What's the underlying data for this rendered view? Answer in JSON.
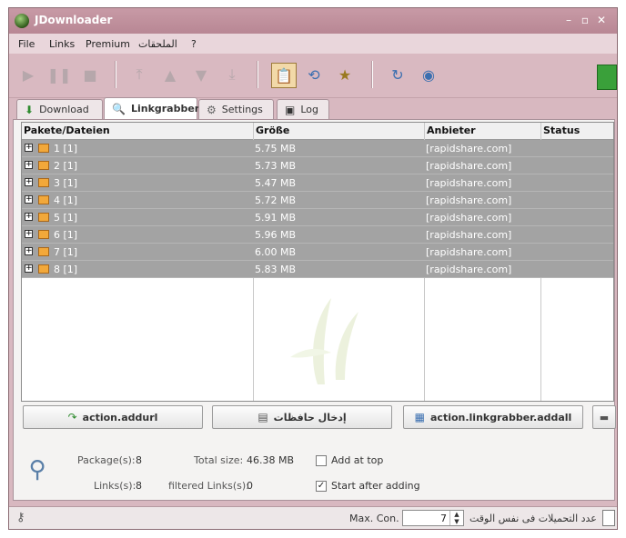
{
  "window": {
    "title": "JDownloader"
  },
  "menu": {
    "items": [
      "File",
      "Links",
      "Premium",
      "الملحقات",
      "?"
    ]
  },
  "tabs": [
    {
      "label": "Download",
      "icon": "down-arrow-icon"
    },
    {
      "label": "Linkgrabber",
      "icon": "linkgrabber-icon"
    },
    {
      "label": "Settings",
      "icon": "gear-icon"
    },
    {
      "label": "Log",
      "icon": "log-icon"
    }
  ],
  "table": {
    "headers": [
      "Pakete/Dateien",
      "Größe",
      "Anbieter",
      "Status"
    ],
    "rows": [
      {
        "name": "1 [1]",
        "size": "5.75 MB",
        "provider": "[rapidshare.com]",
        "status": ""
      },
      {
        "name": "2 [1]",
        "size": "5.73 MB",
        "provider": "[rapidshare.com]",
        "status": ""
      },
      {
        "name": "3 [1]",
        "size": "5.47 MB",
        "provider": "[rapidshare.com]",
        "status": ""
      },
      {
        "name": "4 [1]",
        "size": "5.72 MB",
        "provider": "[rapidshare.com]",
        "status": ""
      },
      {
        "name": "5 [1]",
        "size": "5.91 MB",
        "provider": "[rapidshare.com]",
        "status": ""
      },
      {
        "name": "6 [1]",
        "size": "5.96 MB",
        "provider": "[rapidshare.com]",
        "status": ""
      },
      {
        "name": "7 [1]",
        "size": "6.00 MB",
        "provider": "[rapidshare.com]",
        "status": ""
      },
      {
        "name": "8 [1]",
        "size": "5.83 MB",
        "provider": "[rapidshare.com]",
        "status": ""
      }
    ]
  },
  "actions": {
    "addurl": "action.addurl",
    "clipboard": "إدخال حافظات",
    "addall": "action.linkgrabber.addall"
  },
  "stats": {
    "packages_label": "Package(s):",
    "packages_value": "8",
    "total_size_label": "Total size:",
    "total_size_value": "46.38 MB",
    "links_label": "Links(s):",
    "links_value": "8",
    "filtered_label": "filtered Links(s):",
    "filtered_value": "0",
    "add_at_top_label": "Add at top",
    "add_at_top_checked": false,
    "start_after_adding_label": "Start after adding",
    "start_after_adding_checked": true
  },
  "statusbar": {
    "max_con_label": "Max. Con.",
    "max_con_value": "7",
    "concurrent_label": "عدد التحميلات فى نفس الوقت"
  },
  "colors": {
    "title_bar": "#c89aa6",
    "row_selected": "#a3a3a3",
    "package_icon": "#f2a83a"
  }
}
